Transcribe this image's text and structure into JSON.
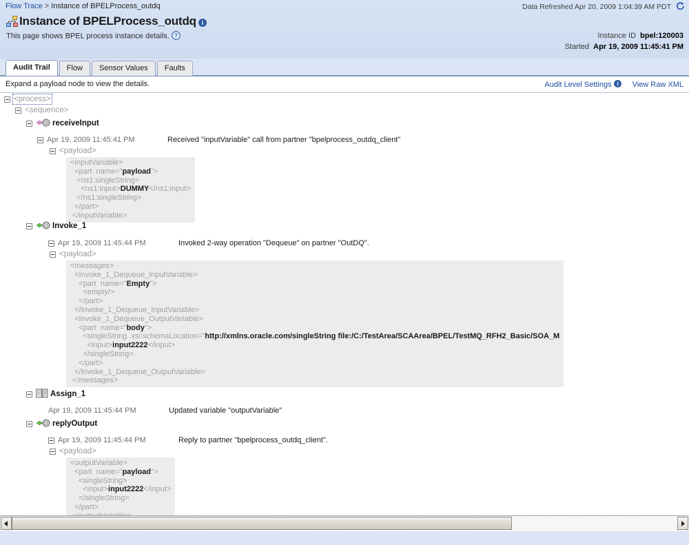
{
  "breadcrumb": {
    "root": "Flow Trace",
    "separator": ">",
    "current": "Instance of BPELProcess_outdq"
  },
  "header": {
    "data_refreshed": "Data Refreshed Apr 20, 2009 1:04:39 AM PDT",
    "refresh_icon": "refresh-icon",
    "title": "Instance of BPELProcess_outdq",
    "title_icon": "bpel-instance-icon",
    "title_info_icon": "info-icon",
    "subtitle": "This page shows BPEL process instance details.",
    "help_icon": "help-icon",
    "instance_id_label": "Instance ID",
    "instance_id_value": "bpel:120003",
    "started_label": "Started",
    "started_value": "Apr 19, 2009 11:45:41 PM"
  },
  "tabs": [
    {
      "label": "Audit Trail",
      "active": true
    },
    {
      "label": "Flow",
      "active": false
    },
    {
      "label": "Sensor Values",
      "active": false
    },
    {
      "label": "Faults",
      "active": false
    }
  ],
  "toolbar": {
    "hint": "Expand a payload node to view the details.",
    "audit_level_settings": "Audit Level Settings",
    "audit_info_icon": "info-icon",
    "view_raw_xml": "View Raw XML"
  },
  "tree": {
    "process_tag": "<process>",
    "sequence_tag": "<sequence>",
    "payload_tag": "<payload>",
    "activities": [
      {
        "name": "receiveInput",
        "icon": "receive-activity-icon",
        "time": "Apr 19, 2009 11:45:41 PM",
        "message": "Received \"inputVariable\" call from partner \"bpelprocess_outdq_client\"",
        "payload": "<inputVariable>\n  <part  name=\"payload\">\n   <ns1:singleString>\n     <ns1:input>DUMMY</ns1:input>\n   </ns1:singleString>\n  </part>\n </inputVariable>"
      },
      {
        "name": "Invoke_1",
        "icon": "invoke-activity-icon",
        "time": "Apr 19, 2009 11:45:44 PM",
        "message": "Invoked 2-way operation \"Dequeue\" on partner \"OutDQ\".",
        "payload": "<messages>\n  <Invoke_1_Dequeue_InputVariable>\n    <part  name=\"Empty\">\n      <empty/>\n    </part>\n  </Invoke_1_Dequeue_InputVariable>\n  <Invoke_1_Dequeue_OutputVariable>\n    <part  name=\"body\">\n      <singleString  xsi:schemaLocation=\"http://xmlns.oracle.com/singleString file:/C:/TestArea/SCAArea/BPEL/TestMQ_RFH2_Basic/SOA_M\n        <input>input2222</input>\n      </singleString>\n    </part>\n  </Invoke_1_Dequeue_OutputVariable>\n </messages>"
      },
      {
        "name": "Assign_1",
        "icon": "assign-activity-icon",
        "time": "Apr 19, 2009 11:45:44 PM",
        "message": "Updated variable \"outputVariable\"",
        "payload": null
      },
      {
        "name": "replyOutput",
        "icon": "reply-activity-icon",
        "time": "Apr 19, 2009 11:45:44 PM",
        "message": "Reply to partner \"bpelprocess_outdq_client\".",
        "payload": "<outputVariable>\n  <part  name=\"payload\">\n    <singleString>\n      <input>input2222</input>\n    </singleString>\n  </part>\n </outputVariable>"
      }
    ]
  },
  "scrollbar": {
    "left_arrow_icon": "arrow-left-icon",
    "right_arrow_icon": "arrow-right-icon"
  },
  "colors": {
    "page_bg": "#dbe5f5",
    "panel_bg": "#ffffff",
    "link": "#1f4ea1",
    "payload_bg": "#ececec",
    "tag_gray": "#9a9a9a",
    "tab_border": "#8196b5"
  }
}
